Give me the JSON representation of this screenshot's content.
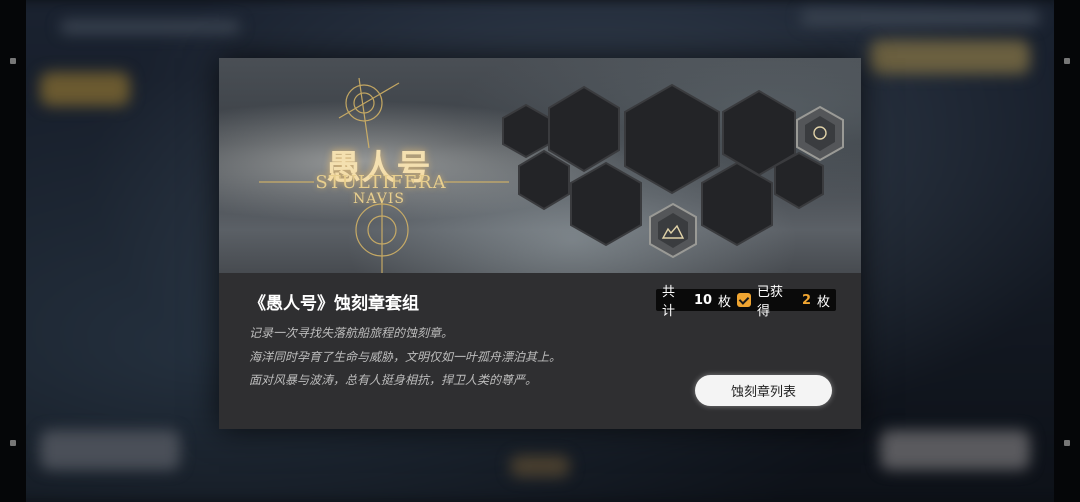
{
  "banner": {
    "logo_title": "愚人号",
    "logo_subtitle_1": "STULTIFERA",
    "logo_subtitle_2": "NAVIS"
  },
  "set": {
    "title": "《愚人号》蚀刻章套组",
    "total_prefix": "共计",
    "total_count": "10",
    "total_unit": "枚",
    "obtained_prefix": "已获得",
    "obtained_count": "2",
    "obtained_unit": "枚"
  },
  "description": [
    "记录一次寻找失落航船旅程的蚀刻章。",
    "海洋同时孕育了生命与威胁，文明仅如一叶孤舟漂泊其上。",
    "面对风暴与波涛，总有人挺身相抗，捍卫人类的尊严。"
  ],
  "buttons": {
    "medal_list": "蚀刻章列表"
  },
  "colors": {
    "accent": "#f0a531",
    "panel": "#2f2f31",
    "logo_gold": "#e8cf8e"
  }
}
